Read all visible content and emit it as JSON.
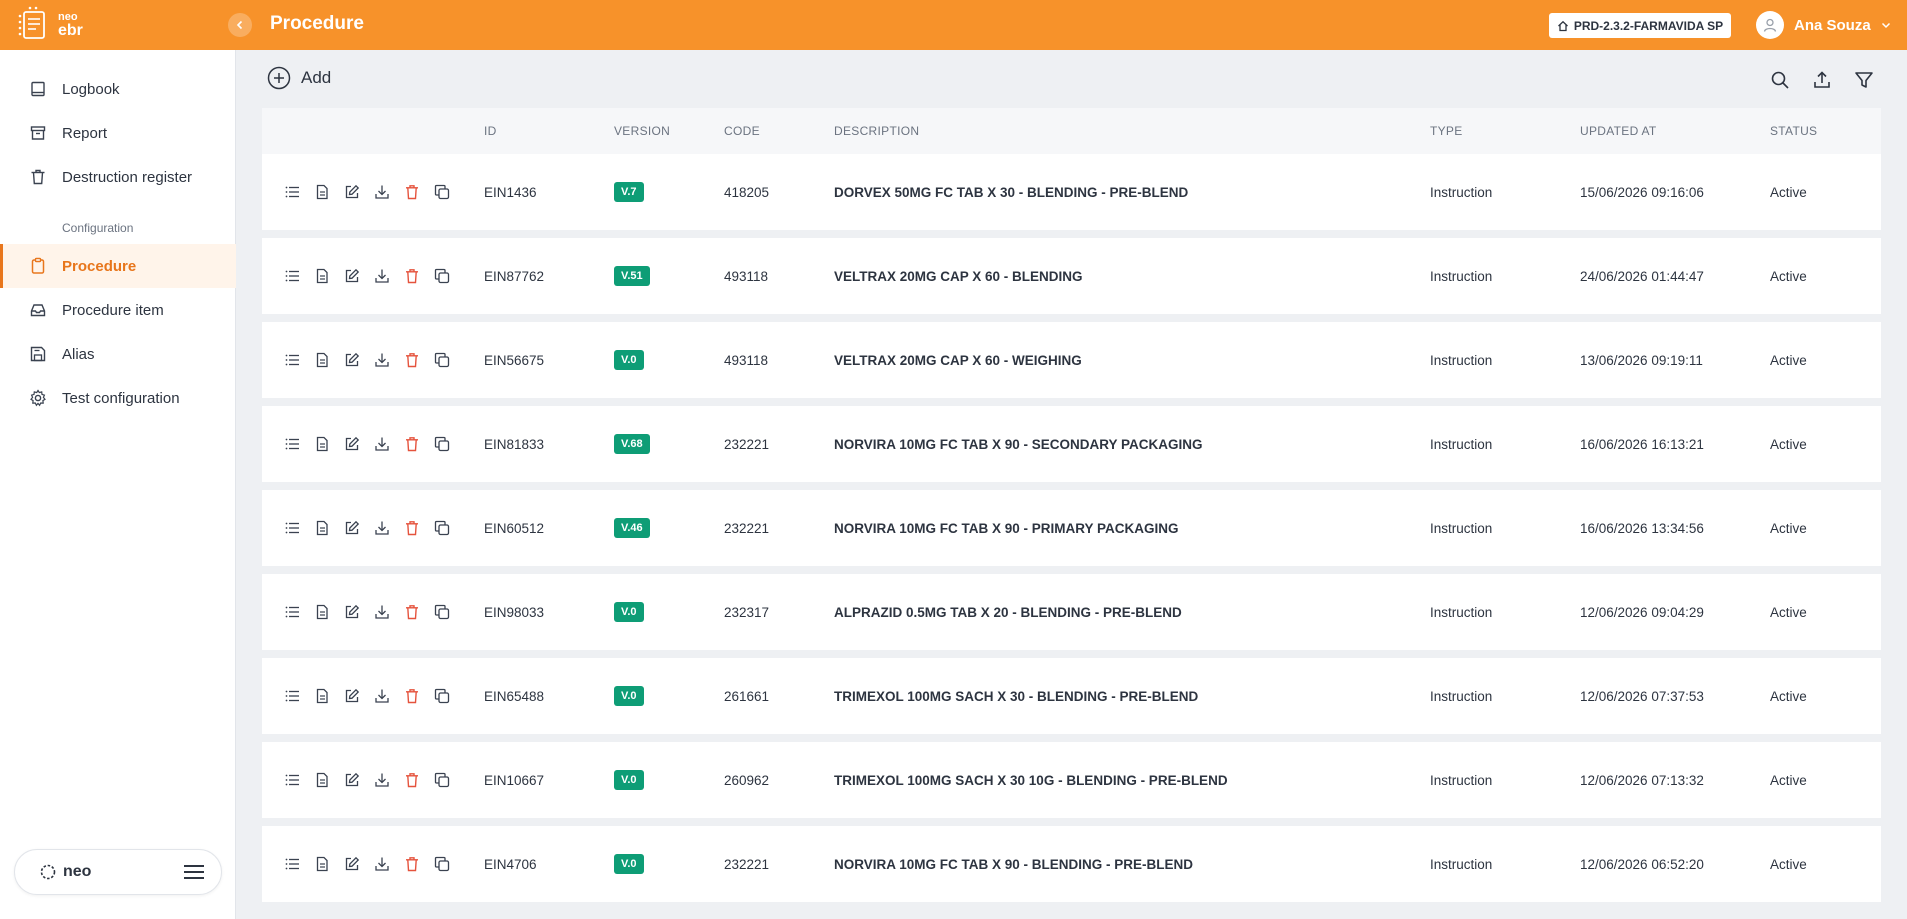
{
  "app": {
    "logo_small": "neo",
    "logo_big": "ebr",
    "page_title": "Procedure",
    "environment": "PRD-2.3.2-FARMAVIDA SP",
    "user_name": "Ana Souza"
  },
  "sidebar": {
    "items": [
      {
        "label": "Logbook",
        "icon": "book-icon"
      },
      {
        "label": "Report",
        "icon": "archive-icon"
      },
      {
        "label": "Destruction register",
        "icon": "trash-icon"
      }
    ],
    "section_label": "Configuration",
    "config_items": [
      {
        "label": "Procedure",
        "icon": "clipboard-icon",
        "active": true
      },
      {
        "label": "Procedure item",
        "icon": "inbox-icon"
      },
      {
        "label": "Alias",
        "icon": "save-icon"
      },
      {
        "label": "Test configuration",
        "icon": "gear-icon"
      }
    ],
    "footer_logo": "neo"
  },
  "toolbar": {
    "add_label": "Add"
  },
  "table": {
    "headers": {
      "id": "ID",
      "version": "VERSION",
      "code": "CODE",
      "description": "DESCRIPTION",
      "type": "TYPE",
      "updated_at": "UPDATED AT",
      "status": "STATUS"
    },
    "rows": [
      {
        "id": "EIN1436",
        "version": "V.7",
        "code": "418205",
        "description": "DORVEX 50MG FC TAB X 30 - BLENDING - PRE-BLEND",
        "type": "Instruction",
        "updated_at": "15/06/2026 09:16:06",
        "status": "Active"
      },
      {
        "id": "EIN87762",
        "version": "V.51",
        "code": "493118",
        "description": "VELTRAX 20MG CAP X 60 - BLENDING",
        "type": "Instruction",
        "updated_at": "24/06/2026 01:44:47",
        "status": "Active"
      },
      {
        "id": "EIN56675",
        "version": "V.0",
        "code": "493118",
        "description": "VELTRAX 20MG CAP X 60 - WEIGHING",
        "type": "Instruction",
        "updated_at": "13/06/2026 09:19:11",
        "status": "Active"
      },
      {
        "id": "EIN81833",
        "version": "V.68",
        "code": "232221",
        "description": "NORVIRA 10MG FC TAB X 90 - SECONDARY PACKAGING",
        "type": "Instruction",
        "updated_at": "16/06/2026 16:13:21",
        "status": "Active"
      },
      {
        "id": "EIN60512",
        "version": "V.46",
        "code": "232221",
        "description": "NORVIRA 10MG FC TAB X 90 - PRIMARY PACKAGING",
        "type": "Instruction",
        "updated_at": "16/06/2026 13:34:56",
        "status": "Active"
      },
      {
        "id": "EIN98033",
        "version": "V.0",
        "code": "232317",
        "description": "ALPRAZID 0.5MG TAB X 20 - BLENDING - PRE-BLEND",
        "type": "Instruction",
        "updated_at": "12/06/2026 09:04:29",
        "status": "Active"
      },
      {
        "id": "EIN65488",
        "version": "V.0",
        "code": "261661",
        "description": "TRIMEXOL 100MG SACH X 30 - BLENDING - PRE-BLEND",
        "type": "Instruction",
        "updated_at": "12/06/2026 07:37:53",
        "status": "Active"
      },
      {
        "id": "EIN10667",
        "version": "V.0",
        "code": "260962",
        "description": "TRIMEXOL 100MG SACH X 30 10G - BLENDING - PRE-BLEND",
        "type": "Instruction",
        "updated_at": "12/06/2026 07:13:32",
        "status": "Active"
      },
      {
        "id": "EIN4706",
        "version": "V.0",
        "code": "232221",
        "description": "NORVIRA 10MG FC TAB X 90 - BLENDING - PRE-BLEND",
        "type": "Instruction",
        "updated_at": "12/06/2026 06:52:20",
        "status": "Active"
      }
    ]
  },
  "colors": {
    "brand": "#f7922a",
    "active_nav": "#e8761c",
    "version_badge": "#0e9d76",
    "delete_icon": "#e5533d"
  }
}
